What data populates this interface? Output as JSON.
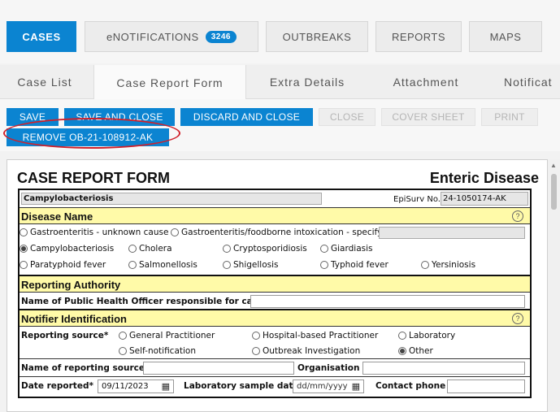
{
  "topnav": {
    "cases": "CASES",
    "enotifications": "eNOTIFICATIONS",
    "enotifications_count": "3246",
    "outbreaks": "OUTBREAKS",
    "reports": "REPORTS",
    "maps": "MAPS"
  },
  "subtabs": {
    "case_list": "Case List",
    "case_report_form": "Case Report Form",
    "extra_details": "Extra Details",
    "attachment": "Attachment",
    "notifications": "Notificat"
  },
  "actions": {
    "save": "SAVE",
    "save_and_close": "SAVE AND CLOSE",
    "discard_and_close": "DISCARD AND CLOSE",
    "close": "CLOSE",
    "cover_sheet": "COVER SHEET",
    "print": "PRINT",
    "remove_outbreak": "REMOVE OB-21-108912-AK"
  },
  "form": {
    "title": "CASE REPORT FORM",
    "type": "Enteric Disease",
    "disease_value": "Campylobacteriosis",
    "episurv_label": "EpiSurv No.",
    "episurv_value": "24-1050174-AK",
    "disease_name": {
      "heading": "Disease Name",
      "opt_gastro_unknown": "Gastroenteritis - unknown cause",
      "opt_gastro_foodborne": "Gastroenteritis/foodborne intoxication - specify",
      "opt_campylo": "Campylobacteriosis",
      "opt_cholera": "Cholera",
      "opt_crypto": "Cryptosporidiosis",
      "opt_giardiasis": "Giardiasis",
      "opt_paratyphoid": "Paratyphoid fever",
      "opt_salmonellosis": "Salmonellosis",
      "opt_shigellosis": "Shigellosis",
      "opt_typhoid": "Typhoid fever",
      "opt_yersiniosis": "Yersiniosis"
    },
    "reporting_authority": {
      "heading": "Reporting Authority",
      "officer_label": "Name of Public Health Officer responsible for case"
    },
    "notifier": {
      "heading": "Notifier Identification",
      "source_label": "Reporting source*",
      "opt_gp": "General Practitioner",
      "opt_hospital": "Hospital-based Practitioner",
      "opt_laboratory": "Laboratory",
      "opt_self": "Self-notification",
      "opt_outbreak": "Outbreak Investigation",
      "opt_other": "Other",
      "name_source_label": "Name of reporting source",
      "organisation_label": "Organisation",
      "date_reported_label": "Date reported*",
      "date_reported_value": "09/11/2023",
      "lab_sample_label": "Laboratory sample date",
      "lab_sample_placeholder": "dd/mm/yyyy",
      "contact_phone_label": "Contact phone"
    },
    "help_glyph": "?",
    "calendar_glyph": "▦"
  }
}
